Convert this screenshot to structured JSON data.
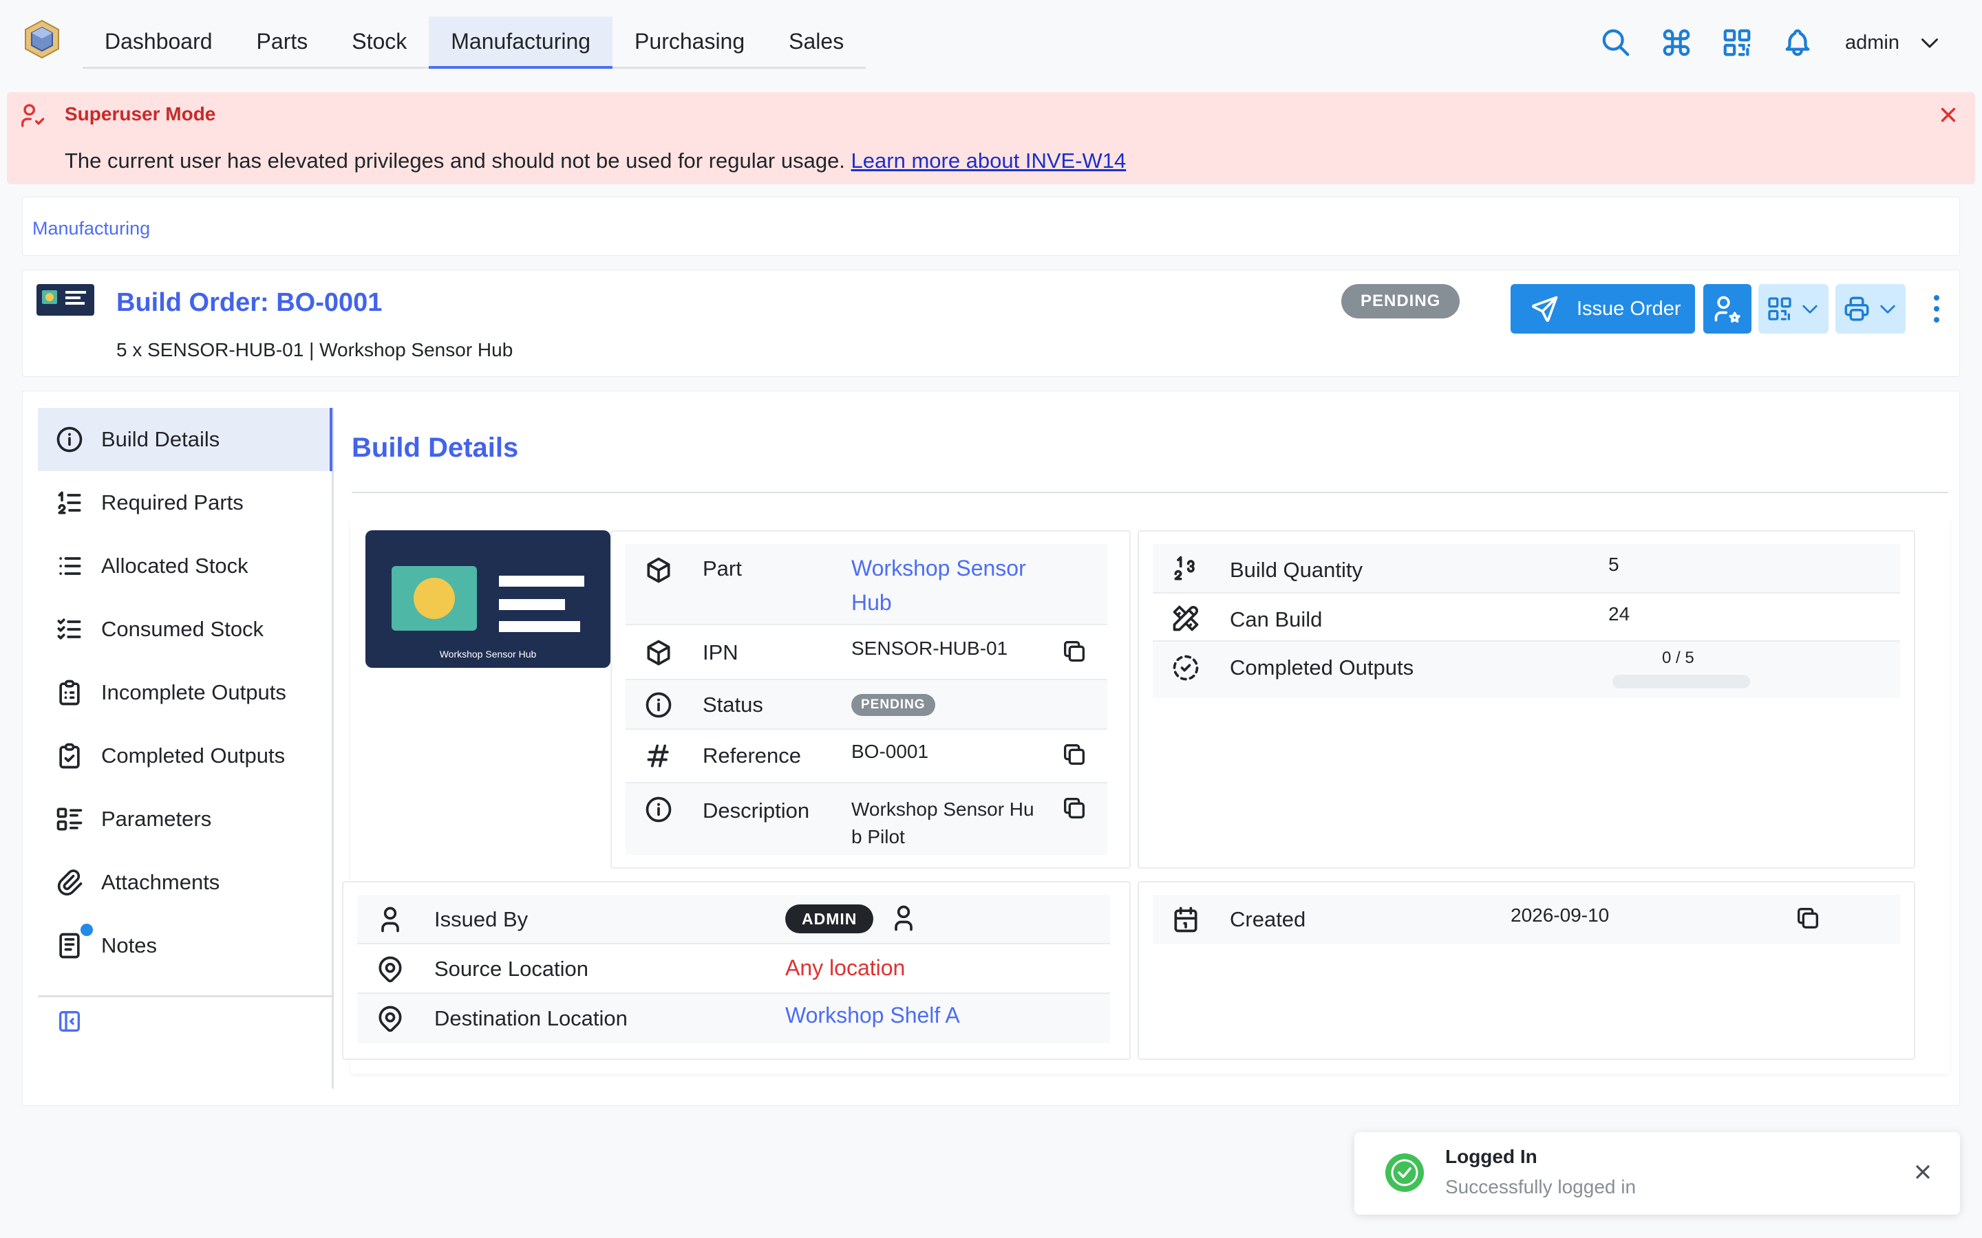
{
  "header": {
    "nav": [
      "Dashboard",
      "Parts",
      "Stock",
      "Manufacturing",
      "Purchasing",
      "Sales"
    ],
    "active_nav": "Manufacturing",
    "user": "admin",
    "icons": [
      "search-icon",
      "command-icon",
      "qr-code-icon",
      "bell-icon",
      "chevron-down-icon"
    ]
  },
  "banner": {
    "title": "Superuser Mode",
    "text": "The current user has elevated privileges and should not be used for regular usage.",
    "link": "Learn more about INVE-W14",
    "color": "#ffe3e3"
  },
  "breadcrumb": "Manufacturing",
  "page": {
    "title": "Build Order: BO-0001",
    "subtitle": "5 x SENSOR-HUB-01 | Workshop Sensor Hub",
    "status": "PENDING",
    "issue_button": "Issue Order",
    "accent": "#228be6"
  },
  "sidebar": {
    "items": [
      {
        "label": "Build Details",
        "icon": "info-circle-icon"
      },
      {
        "label": "Required Parts",
        "icon": "list-numbers-icon"
      },
      {
        "label": "Allocated Stock",
        "icon": "list-icon"
      },
      {
        "label": "Consumed Stock",
        "icon": "list-check-icon"
      },
      {
        "label": "Incomplete Outputs",
        "icon": "clipboard-list-icon"
      },
      {
        "label": "Completed Outputs",
        "icon": "clipboard-check-icon"
      },
      {
        "label": "Parameters",
        "icon": "list-details-icon"
      },
      {
        "label": "Attachments",
        "icon": "paperclip-icon"
      },
      {
        "label": "Notes",
        "icon": "notes-icon"
      }
    ]
  },
  "panel": {
    "title": "Build Details",
    "image_caption": "Workshop Sensor Hub",
    "part": {
      "part_label": "Part",
      "part_value": "Workshop Sensor Hub",
      "ipn_label": "IPN",
      "ipn_value": "SENSOR-HUB-01",
      "status_label": "Status",
      "status_value": "PENDING",
      "reference_label": "Reference",
      "reference_value": "BO-0001",
      "description_label": "Description",
      "description_value": "Workshop Sensor Hub Pilot"
    },
    "quantities": {
      "build_qty_label": "Build Quantity",
      "build_qty_value": "5",
      "can_build_label": "Can Build",
      "can_build_value": "24",
      "completed_label": "Completed Outputs",
      "completed_value": "0 / 5",
      "completed_fraction": 0
    },
    "people": {
      "issued_by_label": "Issued By",
      "issued_by_value": "ADMIN",
      "source_label": "Source Location",
      "source_value": "Any location",
      "dest_label": "Destination Location",
      "dest_value": "Workshop Shelf A"
    },
    "dates": {
      "created_label": "Created",
      "created_value": "2026-09-10"
    }
  },
  "toast": {
    "title": "Logged In",
    "message": "Successfully logged in"
  }
}
